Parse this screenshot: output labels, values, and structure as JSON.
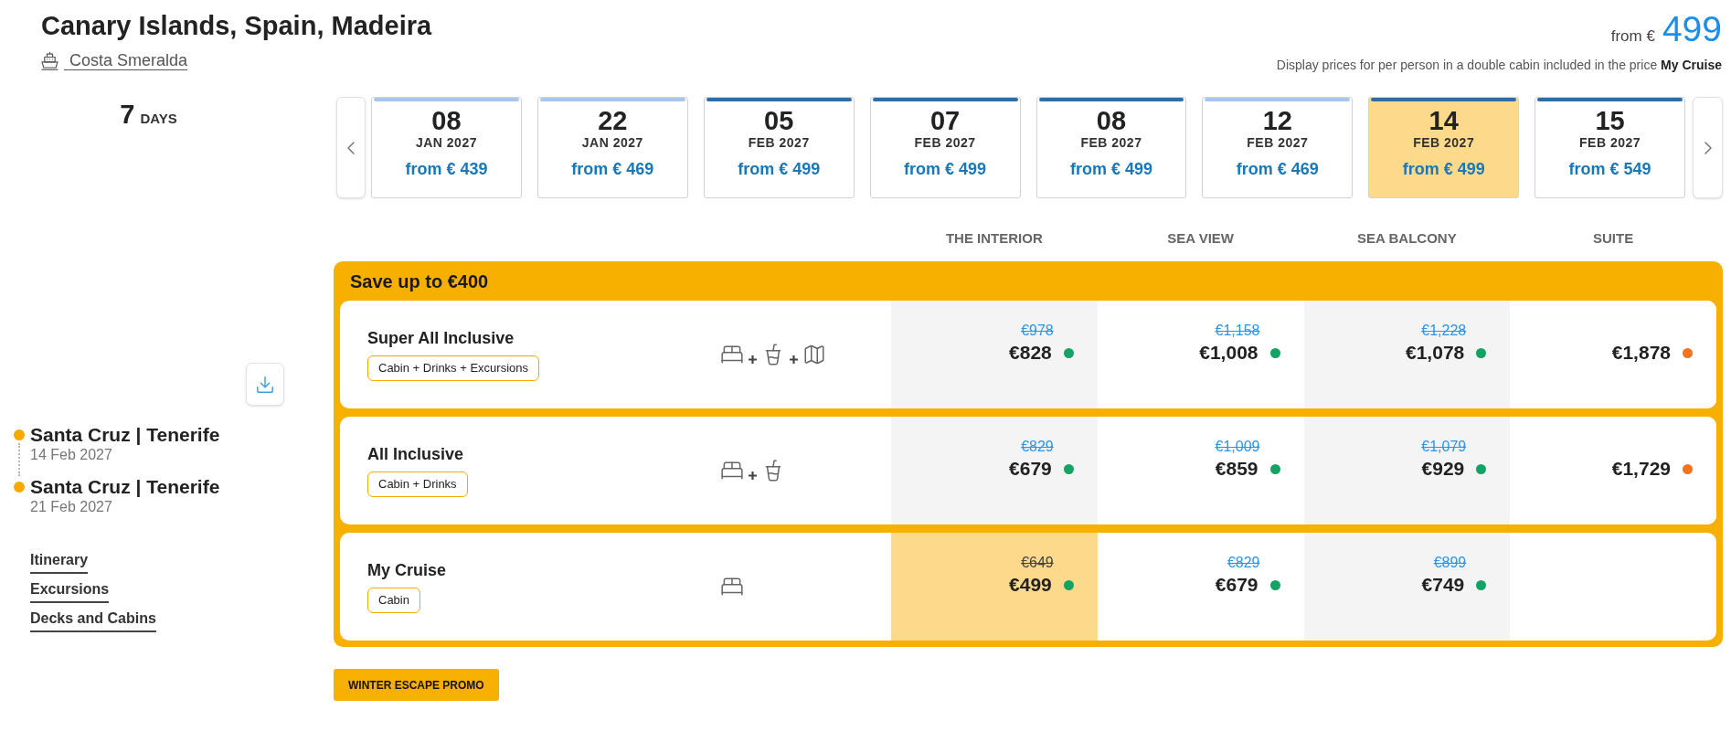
{
  "header": {
    "title": "Canary Islands, Spain, Madeira",
    "ship": "Costa Smeralda",
    "from_label": "from €",
    "from_price": "499",
    "note": "Display prices for per person in a double cabin included in the price **My Cruise**"
  },
  "duration": {
    "number": "7",
    "unit": "DAYS"
  },
  "dates": [
    {
      "day": "08",
      "month": "JAN 2027",
      "price": "from € 439",
      "selected": false,
      "color": "#a6c8ea"
    },
    {
      "day": "22",
      "month": "JAN 2027",
      "price": "from € 469",
      "selected": false,
      "color": "#a6c8ea"
    },
    {
      "day": "05",
      "month": "FEB 2027",
      "price": "from € 499",
      "selected": false,
      "color": "#2f6da6"
    },
    {
      "day": "07",
      "month": "FEB 2027",
      "price": "from € 499",
      "selected": false,
      "color": "#2f6da6"
    },
    {
      "day": "08",
      "month": "FEB 2027",
      "price": "from € 499",
      "selected": false,
      "color": "#2f6da6"
    },
    {
      "day": "12",
      "month": "FEB 2027",
      "price": "from € 469",
      "selected": false,
      "color": "#a6c8ea"
    },
    {
      "day": "14",
      "month": "FEB 2027",
      "price": "from € 499",
      "selected": true,
      "color": "#2f6da6"
    },
    {
      "day": "15",
      "month": "FEB 2027",
      "price": "from € 549",
      "selected": false,
      "color": "#2f6da6"
    }
  ],
  "itinerary": [
    {
      "port": "Santa Cruz | Tenerife",
      "date": "14 Feb 2027"
    },
    {
      "port": "Santa Cruz | Tenerife",
      "date": "21 Feb 2027"
    }
  ],
  "links": [
    "Itinerary",
    "Excursions",
    "Decks and Cabins"
  ],
  "cabin_columns": [
    "THE INTERIOR",
    "SEA VIEW",
    "SEA BALCONY",
    "SUITE"
  ],
  "offer": {
    "banner": "Save up to €400",
    "plans": [
      {
        "name": "Super All Inclusive",
        "badge": "Cabin + Drinks + Excursions",
        "inclusions": [
          {
            "kind": "bed"
          },
          {
            "kind": "drink"
          },
          {
            "kind": "map"
          }
        ],
        "prices": [
          {
            "old": "€978",
            "price": "€828",
            "color": "#13a463",
            "selected": false
          },
          {
            "old": "€1,158",
            "price": "€1,008",
            "color": "#13a463",
            "selected": false
          },
          {
            "old": "€1,228",
            "price": "€1,078",
            "color": "#13a463",
            "selected": false
          },
          {
            "price": "€1,878",
            "color": "#f4731c",
            "selected": false
          }
        ]
      },
      {
        "name": "All Inclusive",
        "badge": "Cabin + Drinks",
        "inclusions": [
          {
            "kind": "bed"
          },
          {
            "kind": "drink"
          }
        ],
        "prices": [
          {
            "old": "€829",
            "price": "€679",
            "color": "#13a463",
            "selected": false
          },
          {
            "old": "€1,009",
            "price": "€859",
            "color": "#13a463",
            "selected": false
          },
          {
            "old": "€1,079",
            "price": "€929",
            "color": "#13a463",
            "selected": false
          },
          {
            "price": "€1,729",
            "color": "#f4731c",
            "selected": false
          }
        ]
      },
      {
        "name": "My Cruise",
        "badge": "Cabin",
        "inclusions": [
          {
            "kind": "bed"
          }
        ],
        "prices": [
          {
            "old": "€649",
            "price": "€499",
            "color": "#13a463",
            "selected": true
          },
          {
            "old": "€829",
            "price": "€679",
            "color": "#13a463",
            "selected": false
          },
          {
            "old": "€899",
            "price": "€749",
            "color": "#13a463",
            "selected": false
          }
        ]
      }
    ]
  },
  "promo": "WINTER ESCAPE PROMO"
}
